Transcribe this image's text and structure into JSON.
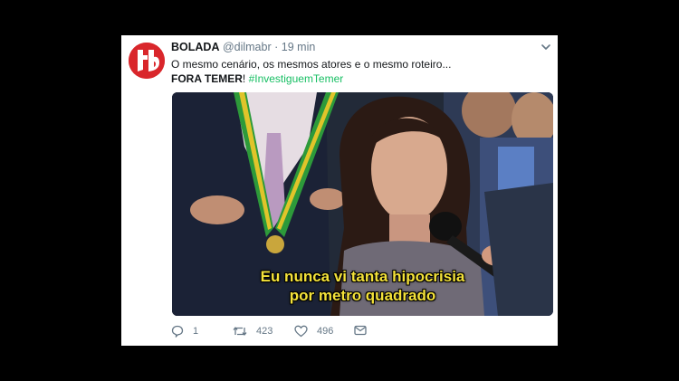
{
  "tweet": {
    "display_name": "BOLADA",
    "handle": "@dilmabr",
    "separator": "·",
    "time": "19 min",
    "line1": "O mesmo cenário, os mesmos atores e o mesmo roteiro...",
    "line2_bold": "FORA TEMER",
    "line2_punct": "! ",
    "hashtag": "#InvestiguemTemer"
  },
  "media": {
    "caption_line1": "Eu nunca vi tanta hipocrisia",
    "caption_line2": "por metro quadrado",
    "caption_color": "#f4e23a"
  },
  "actions": {
    "reply_count": "1",
    "retweet_count": "423",
    "like_count": "496"
  },
  "icons": {
    "menu": "chevron-down-icon",
    "reply": "reply-icon",
    "retweet": "retweet-icon",
    "like": "heart-icon",
    "dm": "envelope-icon"
  },
  "colors": {
    "background": "#000000",
    "card": "#ffffff",
    "text": "#14171a",
    "muted": "#657786",
    "hashtag": "#17bf63",
    "avatar": "#d9262b"
  }
}
